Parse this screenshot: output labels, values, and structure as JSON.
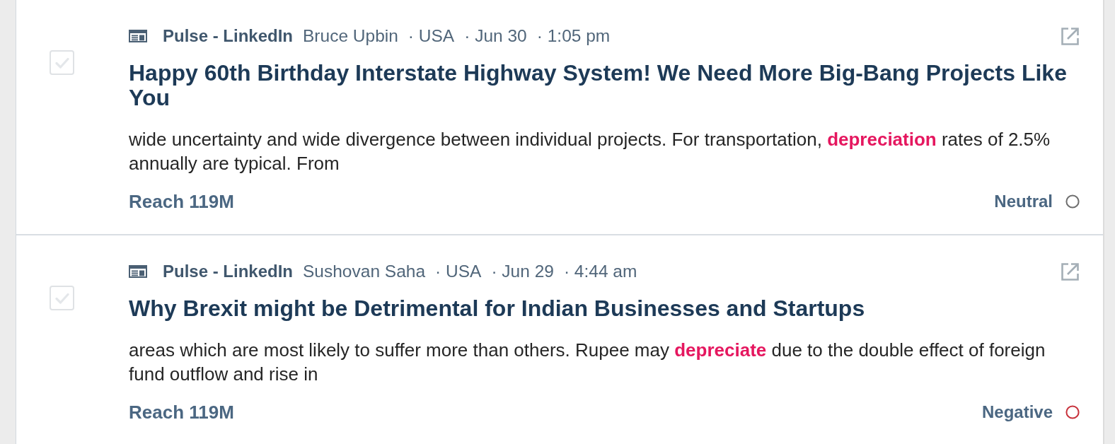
{
  "articles": [
    {
      "checked": false,
      "source": "Pulse - LinkedIn",
      "author": "Bruce Upbin",
      "country": "· USA",
      "date": "· Jun 30",
      "time": "· 1:05 pm",
      "title": "Happy 60th Birthday Interstate Highway System! We Need More Big-Bang Projects Like You",
      "snippet": "wide uncertainty and wide divergence between individual projects. For transportation, **depreciation** rates of 2.5% annually are typical. From",
      "reach": "Reach 119M",
      "sentiment": {
        "label": "Neutral",
        "color": "#6e6e6e"
      }
    },
    {
      "checked": false,
      "source": "Pulse - LinkedIn",
      "author": "Sushovan Saha",
      "country": "· USA",
      "date": "· Jun 29",
      "time": "· 4:44 am",
      "title": "Why Brexit might be Detrimental for Indian Businesses and Startups",
      "snippet": "areas which are most likely to suffer more than others. Rupee may **depreciate** due to the double effect of foreign fund outflow and rise in",
      "reach": "Reach 119M",
      "sentiment": {
        "label": "Negative",
        "color": "#c8323c"
      }
    }
  ]
}
